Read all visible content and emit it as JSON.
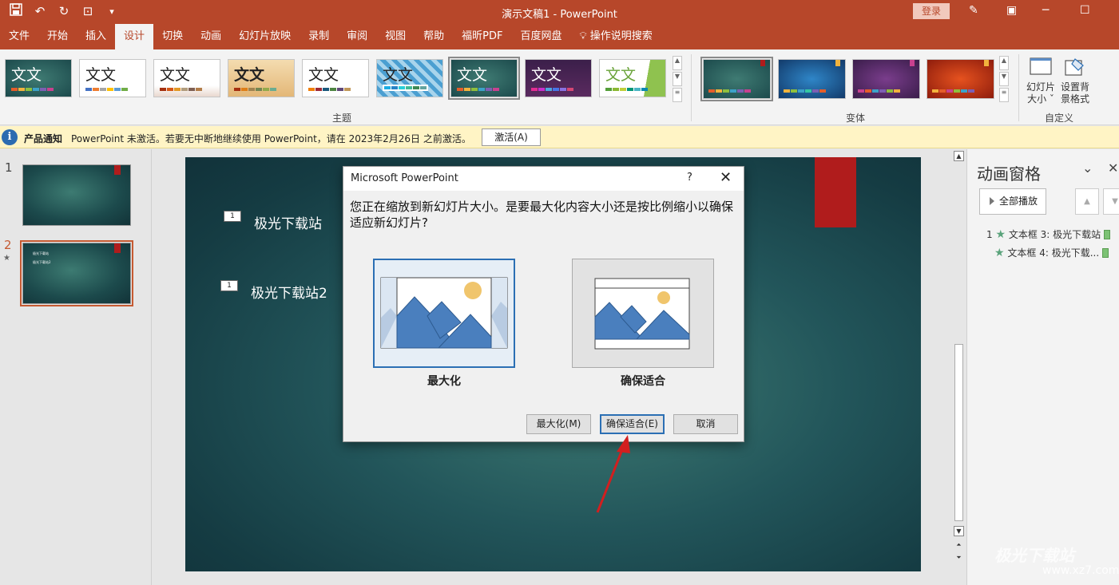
{
  "app": {
    "title": "演示文稿1  -  PowerPoint",
    "login_label": "登录"
  },
  "quick_access": {
    "icons": [
      "save-icon",
      "undo-icon",
      "redo-icon",
      "present-from-start-icon",
      "customize-qat-icon"
    ]
  },
  "tabs": [
    {
      "label": "文件"
    },
    {
      "label": "开始"
    },
    {
      "label": "插入"
    },
    {
      "label": "设计",
      "active": true
    },
    {
      "label": "切换"
    },
    {
      "label": "动画"
    },
    {
      "label": "幻灯片放映"
    },
    {
      "label": "录制"
    },
    {
      "label": "审阅"
    },
    {
      "label": "视图"
    },
    {
      "label": "帮助"
    },
    {
      "label": "福昕PDF"
    },
    {
      "label": "百度网盘"
    },
    {
      "label": "操作说明搜索"
    }
  ],
  "ribbon": {
    "themes_group_label": "主题",
    "variants_group_label": "变体",
    "customize_group_label": "自定义",
    "theme_sample_text": "文文",
    "slide_size_label": "幻灯片\n大小",
    "slide_size_line1": "幻灯片",
    "slide_size_line2": "大小 ˇ",
    "format_bg_line1": "设置背",
    "format_bg_line2": "景格式"
  },
  "notification": {
    "title": "产品通知",
    "message": "PowerPoint 未激活。若要无中断地继续使用 PowerPoint，请在 2023年2月26日 之前激活。",
    "button": "激活(A)"
  },
  "thumbnails": [
    {
      "number": "1"
    },
    {
      "number": "2",
      "has_animation": true,
      "lines": [
        "极光下载站",
        "极光下载站2"
      ]
    }
  ],
  "slide": {
    "text_boxes": [
      {
        "tag": "1",
        "text": "极光下载站"
      },
      {
        "tag": "1",
        "text": "极光下载站2"
      }
    ]
  },
  "animation_pane": {
    "title": "动画窗格",
    "play_all": "全部播放",
    "items": [
      {
        "order": "1",
        "label": "文本框 3: 极光下载站"
      },
      {
        "order": "",
        "label": "文本框 4: 极光下载..."
      }
    ]
  },
  "dialog": {
    "title": "Microsoft PowerPoint",
    "help": "?",
    "message": "您正在缩放到新幻灯片大小。是要最大化内容大小还是按比例缩小以确保适应新幻灯片?",
    "option_maximize": "最大化",
    "option_ensure_fit": "确保适合",
    "btn_maximize": "最大化(M)",
    "btn_ensure_fit": "确保适合(E)",
    "btn_cancel": "取消"
  },
  "watermark": {
    "text": "极光下载站",
    "url": "www.xz7.com"
  },
  "colors": {
    "accent": "#b7472a",
    "slide_bg": "#1f4f55",
    "slide_flag": "#b01c1c",
    "dialog_selection": "#2b6fb4",
    "arrow": "#d21f1f"
  }
}
